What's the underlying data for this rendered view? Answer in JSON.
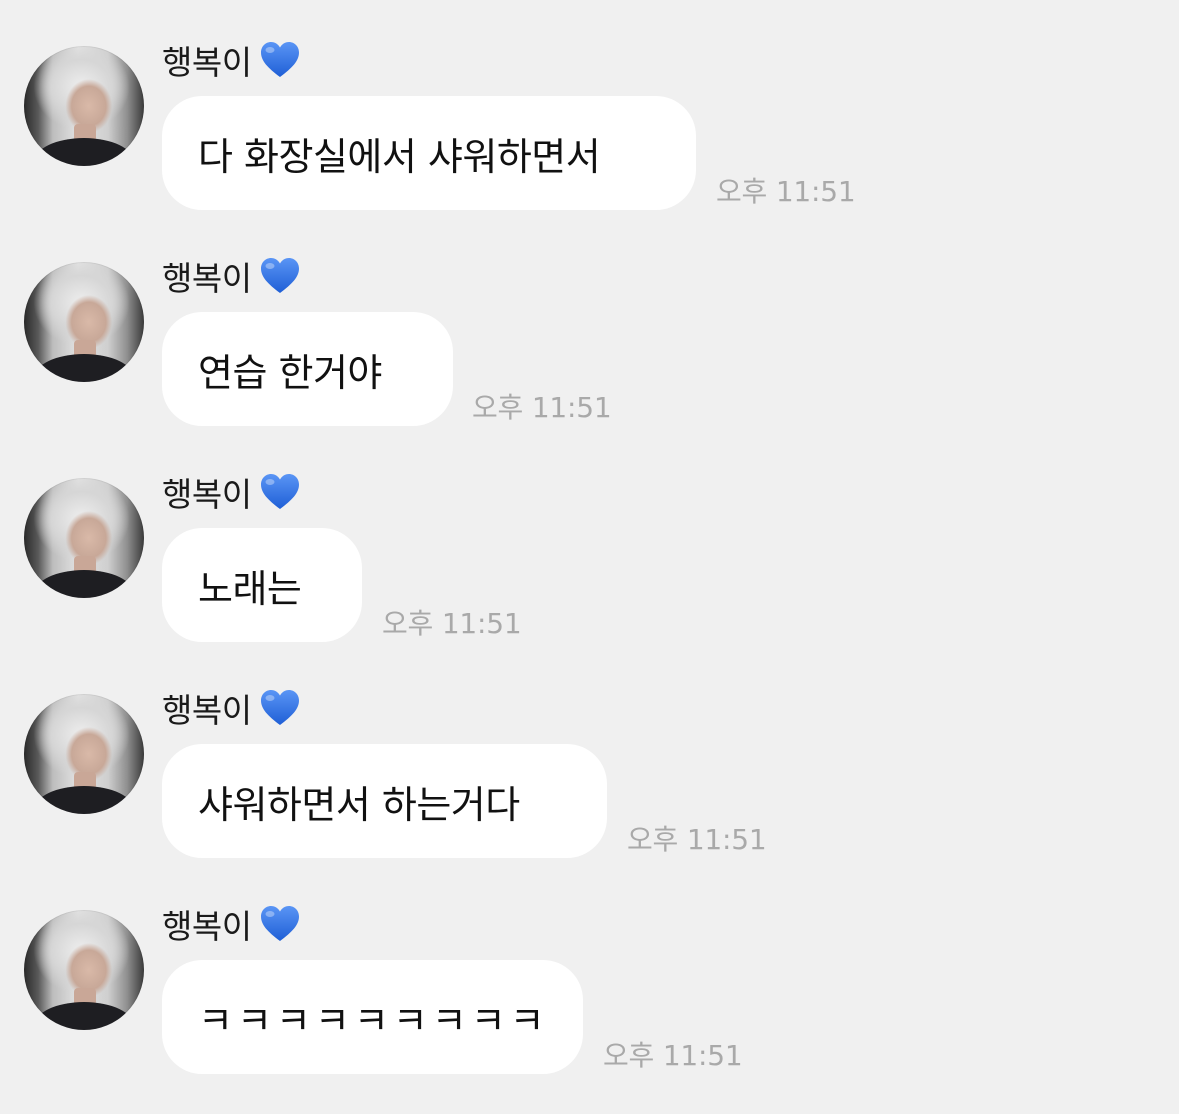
{
  "messages": [
    {
      "sender": "행복이",
      "text": "다 화장실에서 샤워하면서",
      "time": "오후 11:51"
    },
    {
      "sender": "행복이",
      "text": "연습 한거야",
      "time": "오후 11:51"
    },
    {
      "sender": "행복이",
      "text": "노래는",
      "time": "오후 11:51"
    },
    {
      "sender": "행복이",
      "text": "샤워하면서 하는거다",
      "time": "오후 11:51"
    },
    {
      "sender": "행복이",
      "text": "ㅋㅋㅋㅋㅋㅋㅋㅋㅋ",
      "time": "오후 11:51"
    }
  ],
  "icons": {
    "sender_badge": "blue-heart-icon"
  },
  "colors": {
    "background": "#f0f0f0",
    "bubble": "#ffffff",
    "heart": "#2f6fe0",
    "timestamp": "#a9a9a9"
  }
}
